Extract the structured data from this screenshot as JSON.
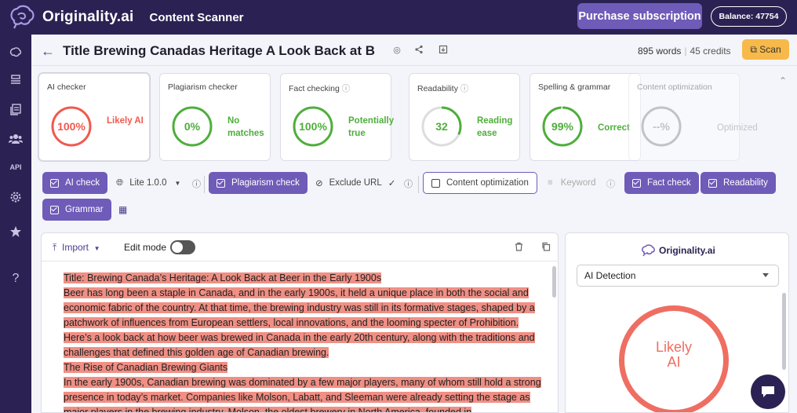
{
  "app": {
    "brand": "Originality.ai",
    "product": "Content Scanner",
    "purchase_label": "Purchase subscription",
    "balance_label": "Balance: 47754"
  },
  "sidebar": {
    "items": [
      {
        "name": "brain-icon"
      },
      {
        "name": "stack-icon"
      },
      {
        "name": "documents-icon"
      },
      {
        "name": "team-icon"
      },
      {
        "name": "api-label",
        "label": "API"
      },
      {
        "name": "settings-icon"
      },
      {
        "name": "star-icon"
      },
      {
        "name": "help-icon",
        "label": "?"
      }
    ]
  },
  "document": {
    "title": "Title Brewing Canadas Heritage A Look Back at B",
    "words": "895 words",
    "credits": "45 credits",
    "scan_label": "Scan"
  },
  "cards": [
    {
      "label": "AI checker",
      "value": "100%",
      "status": "Likely AI",
      "color": "#ef5a4f",
      "fraction": 1.0
    },
    {
      "label": "Plagiarism checker",
      "value": "0%",
      "status": "No matches",
      "color": "#4fae3c",
      "fraction": 1.0
    },
    {
      "label": "Fact checking",
      "value": "100%",
      "status": "Potentially true",
      "color": "#4fae3c",
      "fraction": 1.0
    },
    {
      "label": "Readability",
      "value": "32",
      "status": "Reading ease",
      "color": "#4fae3c",
      "fraction": 0.32
    },
    {
      "label": "Spelling & grammar",
      "value": "99%",
      "status": "Correct",
      "color": "#4fae3c",
      "fraction": 0.99
    },
    {
      "label": "Content optimization",
      "value": "--%",
      "status": "Optimized",
      "color": "#888888",
      "fraction": 1.0
    }
  ],
  "options": {
    "ai_check": "AI check",
    "model": "Lite 1.0.0",
    "plagiarism_check": "Plagiarism check",
    "exclude_url": "Exclude URL",
    "content_optimization": "Content optimization",
    "keyword_placeholder": "Keyword",
    "fact_check": "Fact check",
    "readability": "Readability",
    "grammar": "Grammar"
  },
  "editor": {
    "import_label": "Import",
    "edit_mode_label": "Edit mode",
    "paragraphs": [
      "Title: Brewing Canada’s Heritage: A Look Back at Beer in the Early 1900s",
      "Beer has long been a staple in Canada, and in the early 1900s, it held a unique place in both the social and economic fabric of the country.  At that time, the brewing industry was still in its formative stages, shaped by a patchwork of influences from European settlers, local innovations, and the looming specter of Prohibition.  Here’s a look back at how beer was brewed in Canada in the early 20th century, along with the traditions and challenges that defined this golden age of Canadian brewing.",
      "The Rise of Canadian Brewing Giants",
      "In the early 1900s, Canadian brewing was dominated by a few major players, many of whom still hold a strong presence in today’s market.  Companies like Molson, Labatt, and Sleeman were already setting the stage as major players in the brewing industry.  Molson, the oldest brewery in North America, founded in"
    ]
  },
  "right_panel": {
    "brand": "Originality.ai",
    "select_value": "AI Detection",
    "result_line1": "Likely",
    "result_line2": "AI"
  }
}
